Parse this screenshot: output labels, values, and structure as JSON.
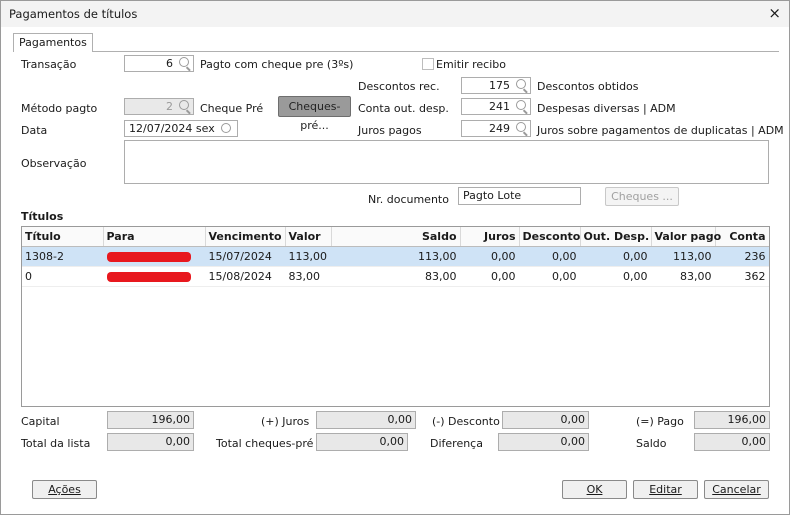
{
  "window": {
    "title": "Pagamentos de títulos",
    "close": "×"
  },
  "tabs": [
    "Pagamentos"
  ],
  "form": {
    "transacao_label": "Transação",
    "transacao_value": "6",
    "transacao_desc": "Pagto com cheque pre (3ºs)",
    "emitir_recibo_label": "Emitir recibo",
    "descontos_rec_label": "Descontos rec.",
    "descontos_rec_value": "175",
    "descontos_rec_desc": "Descontos obtidos",
    "metodo_label": "Método pagto",
    "metodo_value": "2",
    "metodo_desc": "Cheque Pré",
    "cheques_pre_button": "Cheques-pré...",
    "conta_out_label": "Conta out. desp.",
    "conta_out_value": "241",
    "conta_out_desc": "Despesas diversas | ADM",
    "data_label": "Data",
    "data_value": "12/07/2024 sex",
    "juros_label": "Juros pagos",
    "juros_value": "249",
    "juros_desc": "Juros sobre pagamentos de duplicatas | ADM",
    "observacao_label": "Observação",
    "observacao_value": "",
    "nr_documento_label": "Nr. documento",
    "nr_documento_value": "Pagto Lote",
    "cheques_button": "Cheques ..."
  },
  "titulos": {
    "section_label": "Títulos",
    "columns": [
      "Título",
      "Para",
      "Vencimento",
      "Valor",
      "Saldo",
      "Juros",
      "Desconto",
      "Out. Desp.",
      "Valor pago",
      "Conta"
    ],
    "rows": [
      {
        "titulo": "1308-2",
        "para": "",
        "vencimento": "15/07/2024",
        "valor": "113,00",
        "saldo": "113,00",
        "juros": "0,00",
        "desconto": "0,00",
        "out_desp": "0,00",
        "valor_pago": "113,00",
        "conta": "236",
        "selected": true
      },
      {
        "titulo": "0",
        "para": "",
        "vencimento": "15/08/2024",
        "valor": "83,00",
        "saldo": "83,00",
        "juros": "0,00",
        "desconto": "0,00",
        "out_desp": "0,00",
        "valor_pago": "83,00",
        "conta": "362",
        "selected": false
      }
    ]
  },
  "totals": {
    "capital_label": "Capital",
    "capital_value": "196,00",
    "juros_label": "(+) Juros",
    "juros_value": "0,00",
    "desconto_label": "(-) Desconto",
    "desconto_value": "0,00",
    "pago_label": "(=) Pago",
    "pago_value": "196,00",
    "total_lista_label": "Total da lista",
    "total_lista_value": "0,00",
    "total_cheques_label": "Total cheques-pré",
    "total_cheques_value": "0,00",
    "diferenca_label": "Diferença",
    "diferenca_value": "0,00",
    "saldo_label": "Saldo",
    "saldo_value": "0,00"
  },
  "buttons": {
    "acoes": "Ações",
    "ok": "OK",
    "editar": "Editar",
    "cancelar": "Cancelar"
  },
  "colors": {
    "selected_row": "#cfe3f6",
    "redaction": "#e8181e",
    "titlebar": "#f3f3f3"
  },
  "icons": [
    "search-icon",
    "clock-icon",
    "close-icon"
  ]
}
